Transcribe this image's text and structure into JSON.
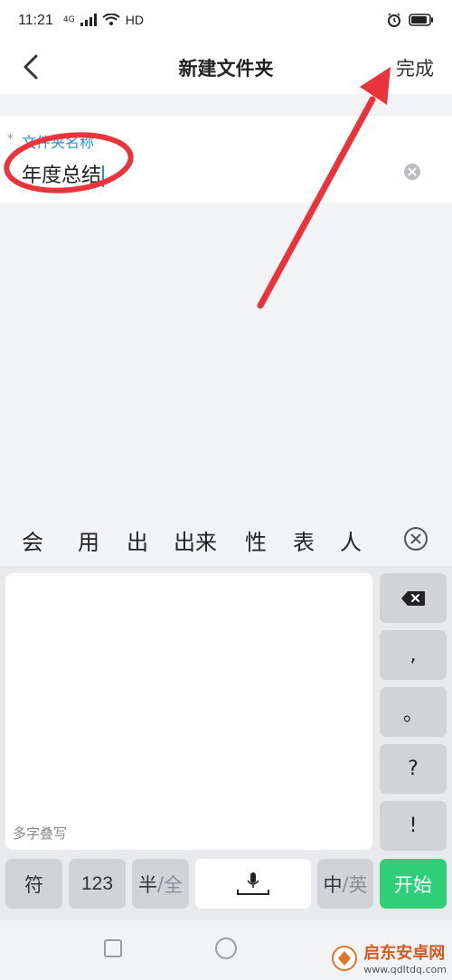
{
  "status_bar": {
    "time": "11:21",
    "network": "4G",
    "hd": "HD"
  },
  "nav": {
    "title": "新建文件夹",
    "done_label": "完成"
  },
  "form": {
    "required_mark": "*",
    "label": "文件夹名称",
    "value": "年度总结"
  },
  "candidates": [
    "会",
    "用",
    "出",
    "出来",
    "性",
    "表",
    "人"
  ],
  "keyboard": {
    "handwrite_hint": "多字叠写",
    "side_keys": [
      ",",
      "。",
      "?",
      "!"
    ],
    "symbol_key": "符",
    "num_key": "123",
    "half_key": "半",
    "full_key": "全",
    "cn_key": "中",
    "en_key": "英",
    "start_key": "开始"
  },
  "watermark": {
    "title": "启东安卓网",
    "url": "www.qdltdq.com"
  },
  "colors": {
    "accent": "#2b8fd8",
    "start": "#2fcf7a",
    "annotation": "#e8343a"
  }
}
